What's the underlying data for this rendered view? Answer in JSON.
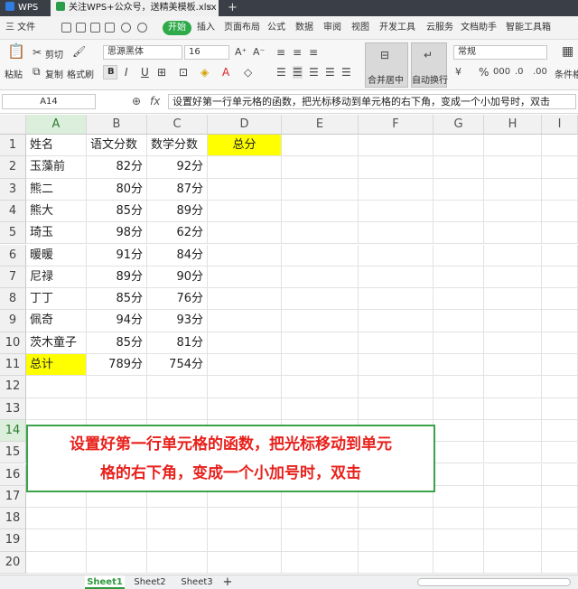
{
  "app": {
    "name": "WPS",
    "tab_title": "关注WPS+公众号，送精美模板.xlsx",
    "new_tab": "+",
    "close": "×"
  },
  "menu": {
    "file": "三 文件",
    "start": "开始",
    "items": [
      "插入",
      "页面布局",
      "公式",
      "数据",
      "审阅",
      "视图",
      "开发工具",
      "云服务",
      "文档助手",
      "智能工具箱"
    ]
  },
  "ribbon": {
    "paste": "粘贴",
    "cut": "剪切",
    "copy": "复制",
    "format_painter": "格式刷",
    "font_name": "思源黑体",
    "font_size": "16",
    "bold": "B",
    "italic": "I",
    "underline": "U",
    "merge_center": "合并居中",
    "wrap_text": "自动换行",
    "number_format": "常规",
    "conditional_format": "条件格"
  },
  "formula_bar": {
    "cell_ref": "A14",
    "fx": "fx",
    "content": "设置好第一行单元格的函数，把光标移动到单元格的右下角，变成一个小加号时，双击"
  },
  "columns": [
    "A",
    "B",
    "C",
    "D",
    "E",
    "F",
    "G",
    "H",
    "I"
  ],
  "rows": [
    {
      "n": "1",
      "a": "姓名",
      "b": "语文分数",
      "c": "数学分数",
      "d": "总分"
    },
    {
      "n": "2",
      "a": "玉藻前",
      "b": "82分",
      "c": "92分",
      "d": ""
    },
    {
      "n": "3",
      "a": "熊二",
      "b": "80分",
      "c": "87分",
      "d": ""
    },
    {
      "n": "4",
      "a": "熊大",
      "b": "85分",
      "c": "89分",
      "d": ""
    },
    {
      "n": "5",
      "a": "琦玉",
      "b": "98分",
      "c": "62分",
      "d": ""
    },
    {
      "n": "6",
      "a": "暖暖",
      "b": "91分",
      "c": "84分",
      "d": ""
    },
    {
      "n": "7",
      "a": "尼禄",
      "b": "89分",
      "c": "90分",
      "d": ""
    },
    {
      "n": "8",
      "a": "丁丁",
      "b": "85分",
      "c": "76分",
      "d": ""
    },
    {
      "n": "9",
      "a": "佩奇",
      "b": "94分",
      "c": "93分",
      "d": ""
    },
    {
      "n": "10",
      "a": "茨木童子",
      "b": "85分",
      "c": "81分",
      "d": ""
    },
    {
      "n": "11",
      "a": "总计",
      "b": "789分",
      "c": "754分",
      "d": ""
    },
    {
      "n": "12",
      "a": "",
      "b": "",
      "c": "",
      "d": ""
    },
    {
      "n": "13",
      "a": "",
      "b": "",
      "c": "",
      "d": ""
    },
    {
      "n": "14",
      "a": "",
      "b": "",
      "c": "",
      "d": ""
    },
    {
      "n": "15",
      "a": "",
      "b": "",
      "c": "",
      "d": ""
    },
    {
      "n": "16",
      "a": "",
      "b": "",
      "c": "",
      "d": ""
    },
    {
      "n": "17",
      "a": "",
      "b": "",
      "c": "",
      "d": ""
    },
    {
      "n": "18",
      "a": "",
      "b": "",
      "c": "",
      "d": ""
    },
    {
      "n": "19",
      "a": "",
      "b": "",
      "c": "",
      "d": ""
    },
    {
      "n": "20",
      "a": "",
      "b": "",
      "c": "",
      "d": ""
    }
  ],
  "callout": {
    "line1": "设置好第一行单元格的函数，把光标移动到单元",
    "line2": "格的右下角，变成一个小加号时，双击"
  },
  "sheets": [
    "Sheet1",
    "Sheet2",
    "Sheet3"
  ],
  "add_sheet": "+",
  "colors": {
    "highlight": "#ffff00",
    "accent_green": "#2eaa4a",
    "callout_text": "#e8211c",
    "callout_border": "#3aa34a"
  }
}
